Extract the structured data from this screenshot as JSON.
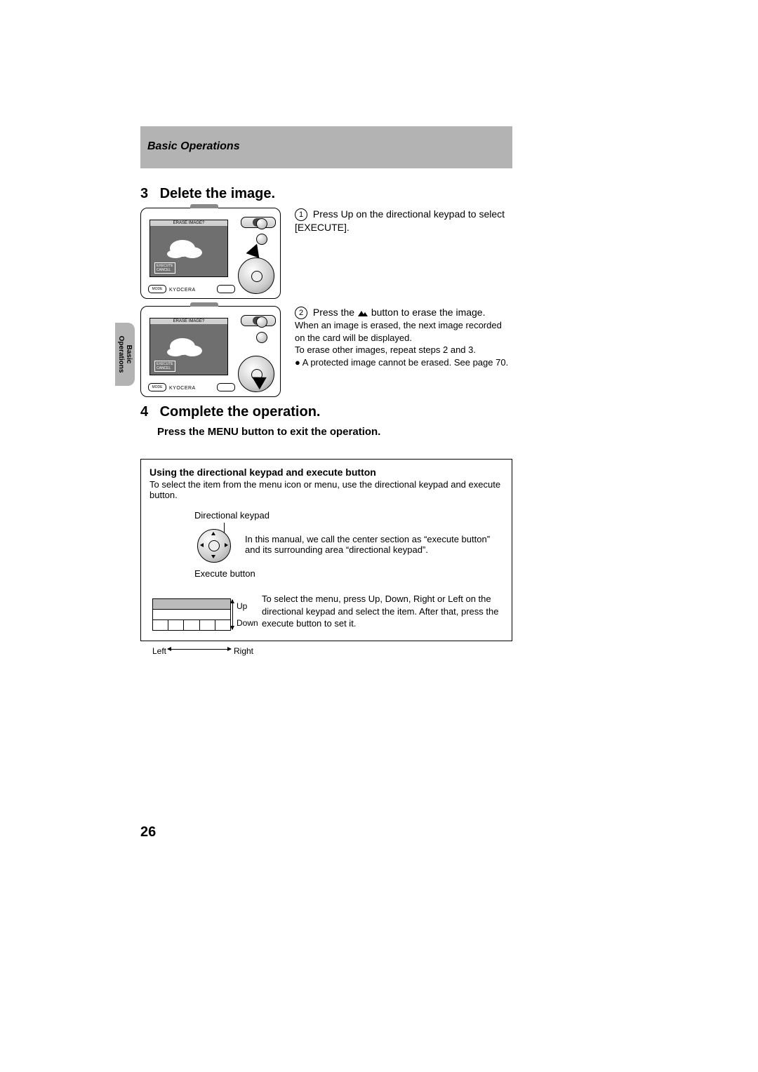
{
  "header": {
    "section": "Basic Operations"
  },
  "sideTab": {
    "line1": "Basic",
    "line2": "Operations"
  },
  "step3": {
    "num": "3",
    "title": "Delete the image.",
    "item1_num": "1",
    "item1_text": "Press Up on the directional keypad to select [EXECUTE].",
    "item2_num": "2",
    "item2_prefix": "Press the ",
    "item2_suffix": " button to erase the image.",
    "note1": "When an image is erased, the next image recorded on the card will be displayed.",
    "note2": "To erase other images, repeat steps 2 and 3.",
    "bullet": "A protected image cannot be erased. See page 70.",
    "lcd_banner": "ERASE IMAGE?",
    "lcd_exec1": "EXECUTE",
    "lcd_exec2": "CANCEL",
    "brand": "KYOCERA",
    "mode": "MODE"
  },
  "step4": {
    "num": "4",
    "title": "Complete the operation.",
    "instruction": "Press the MENU button to exit the operation."
  },
  "infoBox": {
    "title": "Using the directional keypad and execute button",
    "intro": "To select the item from the menu icon or menu, use the directional keypad and execute button.",
    "directionalLabel": "Directional keypad",
    "executeLabel": "Execute button",
    "centerDesc": "In this manual, we call the center section as “execute button” and its surrounding area “directional keypad”.",
    "navDesc": "To select the menu, press Up, Down, Right or Left on the directional keypad and select the item. After that, press the execute button to set it.",
    "up": "Up",
    "down": "Down",
    "left": "Left",
    "right": "Right"
  },
  "pageNumber": "26"
}
